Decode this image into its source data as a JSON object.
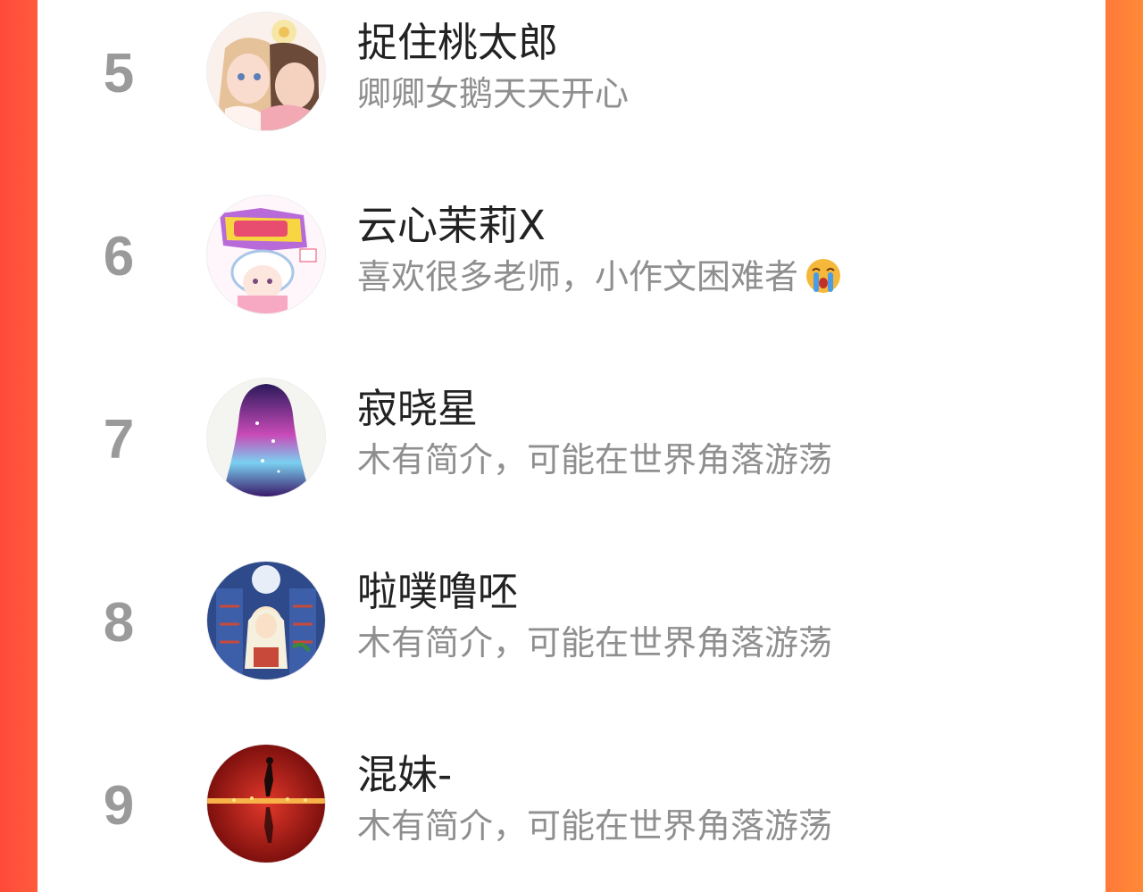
{
  "colors": {
    "background_left": "#ff4a3a",
    "background_right": "#ff8a36",
    "card": "#ffffff",
    "rank": "#9a9a9a",
    "name": "#222222",
    "bio": "#8f8f8f"
  },
  "ranking": {
    "items": [
      {
        "rank": "5",
        "name": "捉住桃太郎",
        "bio": "卿卿女鹅天天开心",
        "avatar_icon": "couple-illustration-avatar",
        "bio_emoji": ""
      },
      {
        "rank": "6",
        "name": "云心茉莉X",
        "bio": "喜欢很多老师，小作文困难者",
        "avatar_icon": "success-sheep-avatar",
        "bio_emoji": "crying-face-emoji"
      },
      {
        "rank": "7",
        "name": "寂晓星",
        "bio": "木有简介，可能在世界角落游荡",
        "avatar_icon": "galaxy-hair-silhouette-avatar",
        "bio_emoji": ""
      },
      {
        "rank": "8",
        "name": "啦噗噜呸",
        "bio": "木有简介，可能在世界角落游荡",
        "avatar_icon": "stained-glass-girl-avatar",
        "bio_emoji": ""
      },
      {
        "rank": "9",
        "name": "混妹-",
        "bio": "木有简介，可能在世界角落游荡",
        "avatar_icon": "red-reflection-figure-avatar",
        "bio_emoji": ""
      }
    ]
  }
}
